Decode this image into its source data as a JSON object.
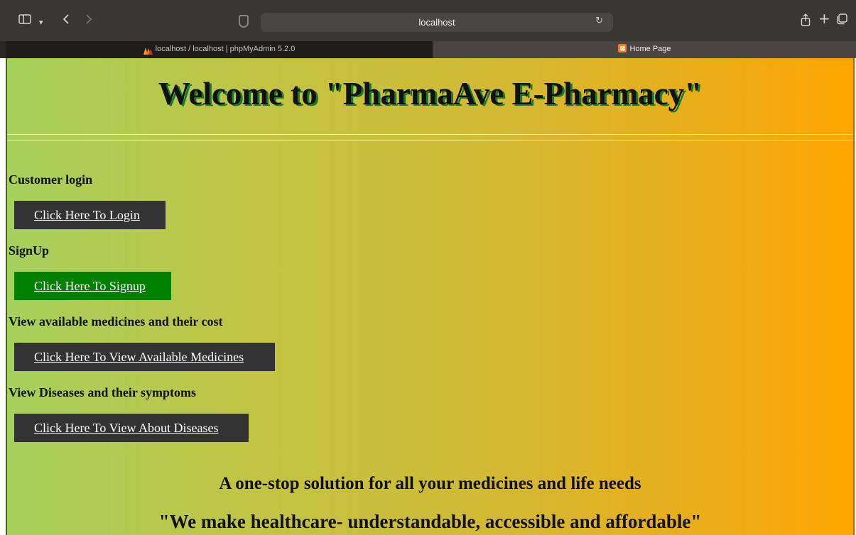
{
  "browser": {
    "url": "localhost",
    "tabs": [
      {
        "title": "localhost / localhost | phpMyAdmin 5.2.0",
        "active": false
      },
      {
        "title": "Home Page",
        "active": true
      }
    ],
    "icons": {
      "sidebar": "sidebar-icon",
      "chevron": "chevron-down-icon",
      "back": "back-icon",
      "forward": "forward-icon",
      "privacy": "shield-icon",
      "reload": "reload-icon",
      "share": "share-icon",
      "new_tab": "plus-icon",
      "tab_overview": "tabs-overview-icon"
    }
  },
  "page": {
    "heading": "Welcome to \"PharmaAve E-Pharmacy\"",
    "sections": [
      {
        "label": "Customer login",
        "button": "Click Here To Login",
        "style": "dark"
      },
      {
        "label": "SignUp",
        "button": "Click Here To Signup",
        "style": "green"
      },
      {
        "label": "View available medicines and their cost",
        "button": "Click Here To View Available Medicines",
        "style": "dark"
      },
      {
        "label": "View Diseases and their symptoms",
        "button": "Click Here To View About Diseases",
        "style": "dark"
      }
    ],
    "tagline": "A one-stop solution for all your medicines and life needs",
    "motto": "\"We make healthcare- understandable, accessible and affordable\""
  },
  "colors": {
    "gradient_start": "#a6d05c",
    "gradient_end": "#ffa500",
    "button_dark": "#333333",
    "button_green": "#008000",
    "heading_shadow": "#1a7a2a"
  }
}
